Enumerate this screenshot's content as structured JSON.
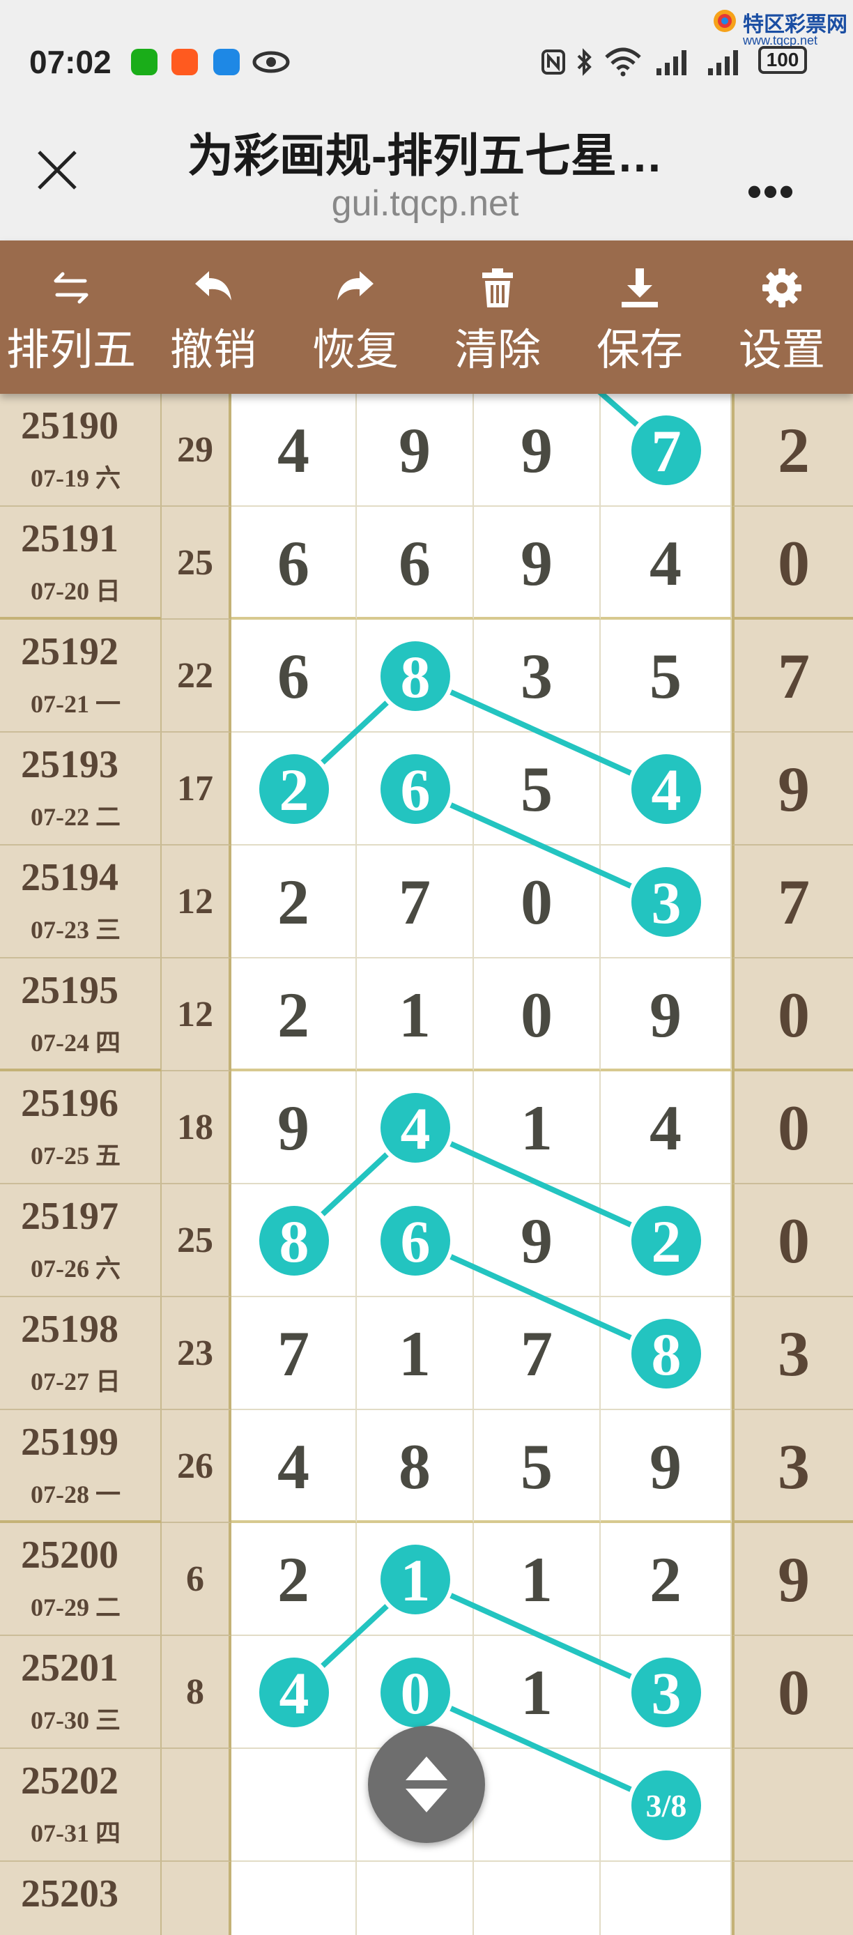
{
  "status_bar": {
    "time": "07:02",
    "brand_name": "特区彩票网",
    "brand_url": "www.tqcp.net",
    "battery": "100",
    "icons": [
      "wechat-icon",
      "taobao-icon",
      "message-icon",
      "eye-icon",
      "nfc-icon",
      "bluetooth-icon",
      "wifi-icon",
      "signal-icon",
      "signal-icon",
      "battery-icon"
    ]
  },
  "browser": {
    "title": "为彩画规-排列五七星…",
    "url": "gui.tqcp.net",
    "close_icon": "close-icon",
    "more_label": "•••"
  },
  "toolbar": {
    "items": [
      {
        "label": "排列五",
        "icon": "switch-arrows-icon"
      },
      {
        "label": "撤销",
        "icon": "undo-icon"
      },
      {
        "label": "恢复",
        "icon": "redo-icon"
      },
      {
        "label": "清除",
        "icon": "trash-icon"
      },
      {
        "label": "保存",
        "icon": "download-icon"
      },
      {
        "label": "设置",
        "icon": "gear-icon"
      }
    ]
  },
  "colors": {
    "toolbar_bg": "#9a6b4c",
    "ball": "#23c4c0",
    "line": "#23c4c0",
    "side_bg": "#e5d9c3",
    "digit": "#4a4a42"
  },
  "rows": [
    {
      "issue": "25190",
      "date": "07-19 六",
      "sum": "29",
      "digits": [
        "4",
        "9",
        "9",
        "7"
      ],
      "last": "2"
    },
    {
      "issue": "25191",
      "date": "07-20 日",
      "sum": "25",
      "digits": [
        "6",
        "6",
        "9",
        "4"
      ],
      "last": "0"
    },
    {
      "issue": "25192",
      "date": "07-21 一",
      "sum": "22",
      "digits": [
        "6",
        "8",
        "3",
        "5"
      ],
      "last": "7"
    },
    {
      "issue": "25193",
      "date": "07-22 二",
      "sum": "17",
      "digits": [
        "2",
        "6",
        "5",
        "4"
      ],
      "last": "9"
    },
    {
      "issue": "25194",
      "date": "07-23 三",
      "sum": "12",
      "digits": [
        "2",
        "7",
        "0",
        "3"
      ],
      "last": "7"
    },
    {
      "issue": "25195",
      "date": "07-24 四",
      "sum": "12",
      "digits": [
        "2",
        "1",
        "0",
        "9"
      ],
      "last": "0"
    },
    {
      "issue": "25196",
      "date": "07-25 五",
      "sum": "18",
      "digits": [
        "9",
        "4",
        "1",
        "4"
      ],
      "last": "0"
    },
    {
      "issue": "25197",
      "date": "07-26 六",
      "sum": "25",
      "digits": [
        "8",
        "6",
        "9",
        "2"
      ],
      "last": "0"
    },
    {
      "issue": "25198",
      "date": "07-27 日",
      "sum": "23",
      "digits": [
        "7",
        "1",
        "7",
        "8"
      ],
      "last": "3"
    },
    {
      "issue": "25199",
      "date": "07-28 一",
      "sum": "26",
      "digits": [
        "4",
        "8",
        "5",
        "9"
      ],
      "last": "3"
    },
    {
      "issue": "25200",
      "date": "07-29 二",
      "sum": "6",
      "digits": [
        "2",
        "1",
        "1",
        "2"
      ],
      "last": "9"
    },
    {
      "issue": "25201",
      "date": "07-30 三",
      "sum": "8",
      "digits": [
        "4",
        "0",
        "1",
        "3"
      ],
      "last": "0"
    },
    {
      "issue": "25202",
      "date": "07-31 四",
      "sum": "",
      "digits": [
        "",
        "",
        "",
        ""
      ],
      "last": ""
    },
    {
      "issue": "25203",
      "date": "",
      "sum": "",
      "digits": [
        "",
        "",
        "",
        ""
      ],
      "last": ""
    }
  ],
  "highlights": [
    {
      "row": 0,
      "col": 3
    },
    {
      "row": 2,
      "col": 1
    },
    {
      "row": 3,
      "col": 0
    },
    {
      "row": 3,
      "col": 1
    },
    {
      "row": 3,
      "col": 3
    },
    {
      "row": 4,
      "col": 3
    },
    {
      "row": 6,
      "col": 1
    },
    {
      "row": 7,
      "col": 0
    },
    {
      "row": 7,
      "col": 1
    },
    {
      "row": 7,
      "col": 3
    },
    {
      "row": 8,
      "col": 3
    },
    {
      "row": 10,
      "col": 1
    },
    {
      "row": 11,
      "col": 0
    },
    {
      "row": 11,
      "col": 1
    },
    {
      "row": 11,
      "col": 3
    }
  ],
  "prediction": {
    "row": 12,
    "col": 3,
    "label": "3/8"
  },
  "lines": [
    [
      {
        "row": 0,
        "col": 3
      },
      {
        "row": -1,
        "col": 2
      }
    ],
    [
      {
        "row": 3,
        "col": 0
      },
      {
        "row": 2,
        "col": 1
      }
    ],
    [
      {
        "row": 2,
        "col": 1
      },
      {
        "row": 3,
        "col": 3
      }
    ],
    [
      {
        "row": 3,
        "col": 1
      },
      {
        "row": 4,
        "col": 3
      }
    ],
    [
      {
        "row": 7,
        "col": 0
      },
      {
        "row": 6,
        "col": 1
      }
    ],
    [
      {
        "row": 6,
        "col": 1
      },
      {
        "row": 7,
        "col": 3
      }
    ],
    [
      {
        "row": 7,
        "col": 1
      },
      {
        "row": 8,
        "col": 3
      }
    ],
    [
      {
        "row": 11,
        "col": 0
      },
      {
        "row": 10,
        "col": 1
      }
    ],
    [
      {
        "row": 10,
        "col": 1
      },
      {
        "row": 11,
        "col": 3
      }
    ],
    [
      {
        "row": 11,
        "col": 1
      },
      {
        "row": 12,
        "col": 3
      }
    ]
  ],
  "separator_after_rows": [
    1,
    5,
    9
  ]
}
